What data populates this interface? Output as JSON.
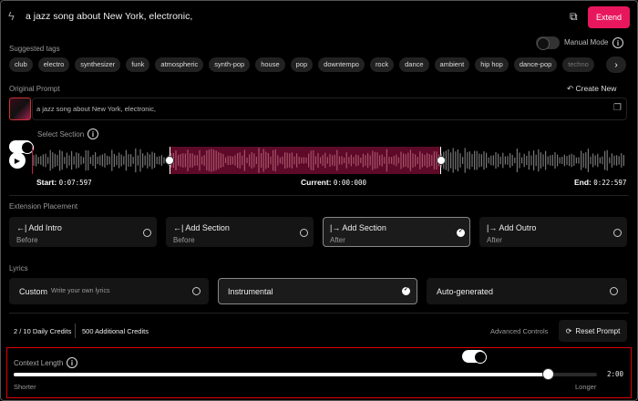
{
  "header": {
    "prompt": "a jazz song about New York, electronic,",
    "extend_label": "Extend",
    "bolt_icon": "lightning-icon",
    "dice_icon": "dice-icon"
  },
  "tags": {
    "label": "Suggested tags",
    "manual_mode_label": "Manual Mode",
    "manual_mode_on": false,
    "items": [
      "club",
      "electro",
      "synthesizer",
      "funk",
      "atmospheric",
      "synth-pop",
      "house",
      "pop",
      "downtempo",
      "rock",
      "dance",
      "ambient",
      "hip hop",
      "dance-pop",
      "techno"
    ]
  },
  "original": {
    "label": "Original Prompt",
    "create_new_label": "Create New",
    "prompt": "a jazz song about New York, electronic,"
  },
  "section": {
    "label": "Select Section",
    "on": true,
    "start_label": "Start:",
    "start": "0:07:597",
    "current_label": "Current:",
    "current": "0:00:000",
    "end_label": "End:",
    "end": "0:22:597"
  },
  "placement": {
    "label": "Extension Placement",
    "options": [
      {
        "icon": "←|",
        "title": "Add Intro",
        "sub": "Before",
        "selected": false
      },
      {
        "icon": "←|",
        "title": "Add Section",
        "sub": "Before",
        "selected": false
      },
      {
        "icon": "|→",
        "title": "Add Section",
        "sub": "After",
        "selected": true
      },
      {
        "icon": "|→",
        "title": "Add Outro",
        "sub": "After",
        "selected": false
      }
    ]
  },
  "lyrics": {
    "label": "Lyrics",
    "custom": "Custom",
    "custom_hint": "Write your own lyrics",
    "instrumental": "Instrumental",
    "auto": "Auto-generated",
    "selected": "instrumental"
  },
  "credits": {
    "daily": "2 / 10 Daily Credits",
    "additional": "500 Additional Credits",
    "advanced_label": "Advanced Controls",
    "advanced_on": true,
    "reset_label": "Reset Prompt"
  },
  "context": {
    "label": "Context Length",
    "value": "2:00",
    "fraction": 0.915,
    "min_label": "Shorter",
    "max_label": "Longer"
  },
  "colors": {
    "accent": "#e8175d",
    "selection": "#5c0a28",
    "highlight_box": "#e00000"
  }
}
